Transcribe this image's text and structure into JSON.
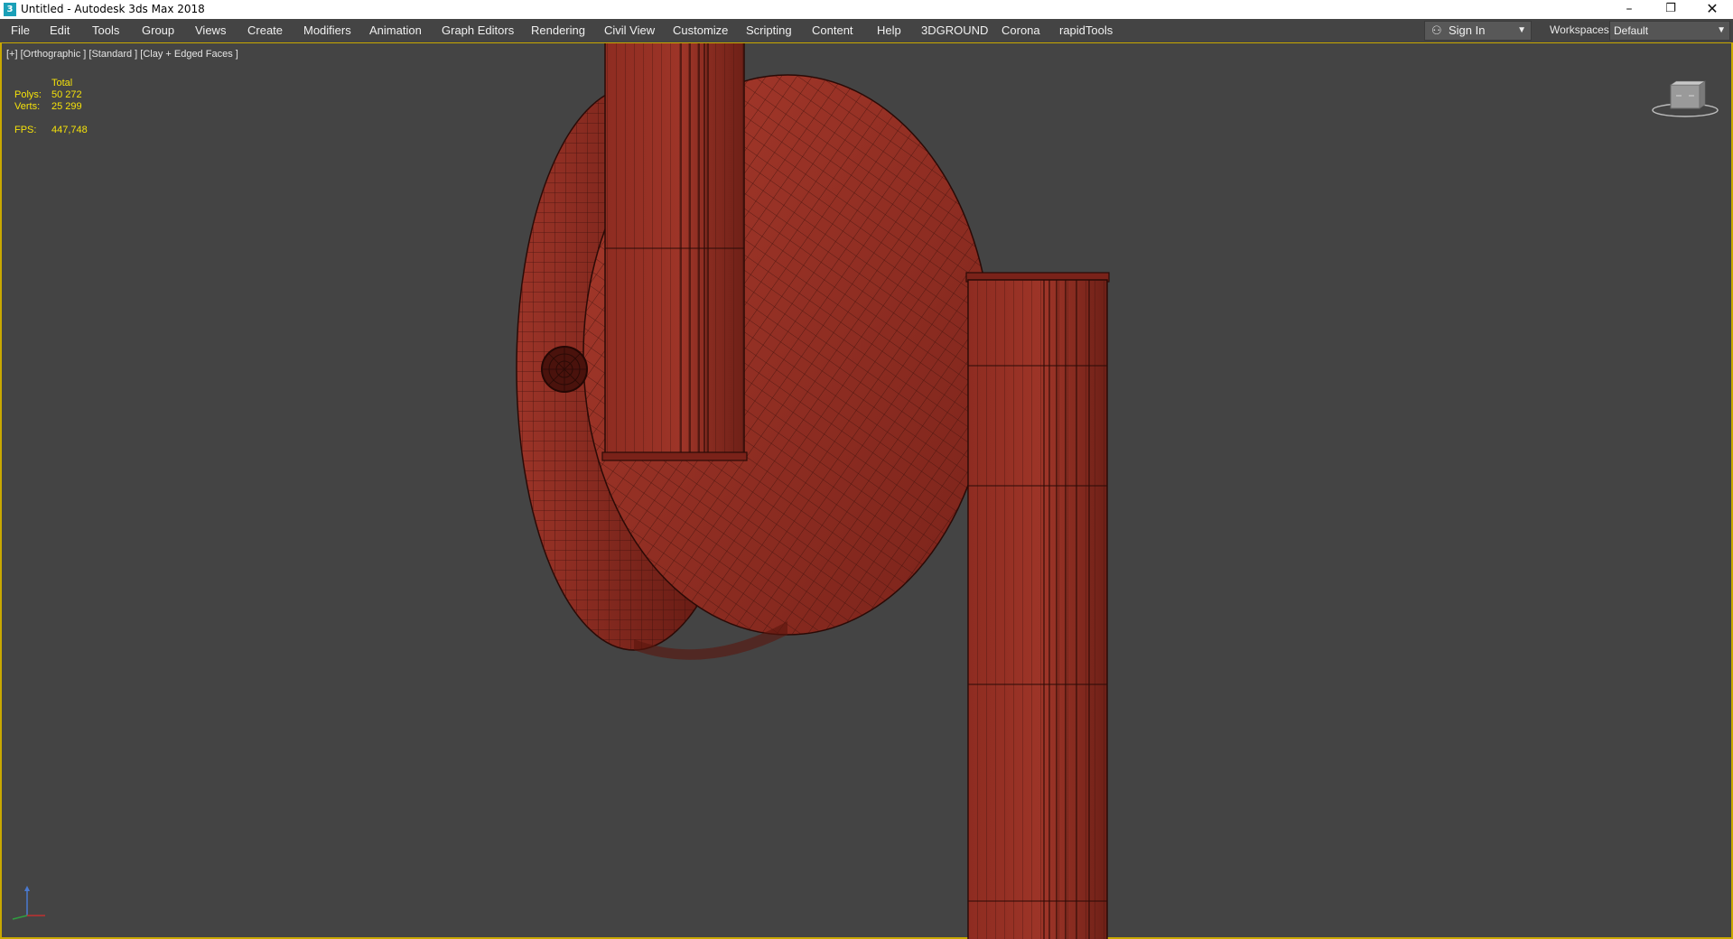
{
  "window": {
    "title": "Untitled - Autodesk 3ds Max 2018",
    "app_icon": "3",
    "controls": {
      "minimize": "–",
      "maximize": "❐",
      "close": "✕"
    }
  },
  "menu": {
    "items": [
      "File",
      "Edit",
      "Tools",
      "Group",
      "Views",
      "Create",
      "Modifiers",
      "Animation",
      "Graph Editors",
      "Rendering",
      "Civil View",
      "Customize",
      "Scripting",
      "Content",
      "Help",
      "3DGROUND",
      "Corona",
      "rapidTools"
    ],
    "sign_in": "Sign In",
    "workspaces_label": "Workspaces:",
    "workspace_value": "Default"
  },
  "viewport": {
    "label": "[+] [Orthographic ] [Standard ] [Clay + Edged Faces ]",
    "stats": {
      "header": "Total",
      "polys_label": "Polys:",
      "polys_value": "50 272",
      "verts_label": "Verts:",
      "verts_value": "25 299",
      "fps_label": "FPS:",
      "fps_value": "447,748"
    }
  },
  "colors": {
    "viewport_bg": "#444444",
    "mesh_fill": "#8e2e22",
    "mesh_wire": "#3a100b",
    "stats_text": "#f5e20a",
    "active_border": "#c8a800"
  }
}
